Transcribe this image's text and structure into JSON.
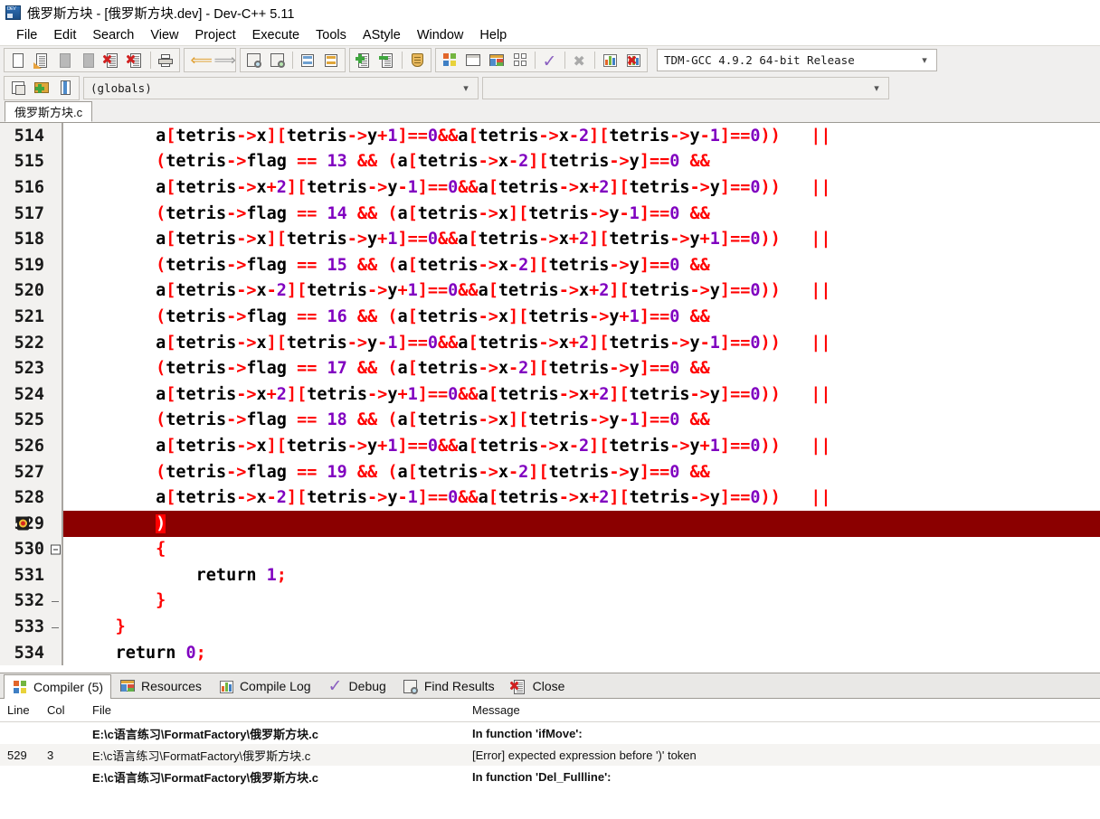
{
  "window": {
    "title": "俄罗斯方块 - [俄罗斯方块.dev] - Dev-C++ 5.11",
    "app_icon": "dev-cpp-icon"
  },
  "menubar": {
    "items": [
      "File",
      "Edit",
      "Search",
      "View",
      "Project",
      "Execute",
      "Tools",
      "AStyle",
      "Window",
      "Help"
    ]
  },
  "toolbar": {
    "groups": [
      {
        "name": "file-group",
        "buttons": [
          {
            "name": "new-file-button",
            "icon": "new-file-icon"
          },
          {
            "name": "open-file-button",
            "icon": "open-file-icon"
          },
          {
            "name": "save-file-button",
            "icon": "save-file-icon"
          },
          {
            "name": "save-all-button",
            "icon": "save-all-icon"
          },
          {
            "name": "close-file-button",
            "icon": "close-file-icon"
          },
          {
            "name": "close-all-button",
            "icon": "close-all-icon"
          },
          {
            "name": "print-button",
            "icon": "print-icon"
          }
        ]
      },
      {
        "name": "undo-group",
        "buttons": [
          {
            "name": "undo-button",
            "icon": "undo-arrow-icon"
          },
          {
            "name": "redo-button",
            "icon": "redo-arrow-icon"
          }
        ]
      },
      {
        "name": "find-group",
        "buttons": [
          {
            "name": "find-button",
            "icon": "find-magnifier-icon"
          },
          {
            "name": "replace-button",
            "icon": "replace-magnifier-icon"
          },
          {
            "name": "goto-line-button",
            "icon": "goto-line-icon"
          },
          {
            "name": "goto-function-button",
            "icon": "goto-function-icon"
          }
        ]
      },
      {
        "name": "project-group",
        "buttons": [
          {
            "name": "add-to-project-button",
            "icon": "add-plus-icon"
          },
          {
            "name": "remove-from-project-button",
            "icon": "remove-minus-icon"
          },
          {
            "name": "project-options-button",
            "icon": "shield-icon"
          }
        ]
      },
      {
        "name": "build-group",
        "buttons": [
          {
            "name": "compile-button",
            "icon": "compile-grid-icon"
          },
          {
            "name": "run-button",
            "icon": "run-window-icon"
          },
          {
            "name": "compile-run-button",
            "icon": "compile-run-icon"
          },
          {
            "name": "rebuild-all-button",
            "icon": "rebuild-grid-icon"
          },
          {
            "name": "syntax-check-button",
            "icon": "check-mark-icon"
          },
          {
            "name": "stop-execution-button",
            "icon": "stop-x-icon"
          },
          {
            "name": "profile-button",
            "icon": "profile-bars-icon"
          },
          {
            "name": "delete-profile-button",
            "icon": "delete-profile-icon"
          }
        ]
      }
    ],
    "compiler_select": {
      "name": "compiler-select",
      "value": "TDM-GCC 4.9.2 64-bit Release"
    },
    "row2": {
      "buttons": [
        {
          "name": "new-project-button",
          "icon": "new-project-icon"
        },
        {
          "name": "add-source-button",
          "icon": "add-source-icon"
        },
        {
          "name": "toggle-bookmark-button",
          "icon": "bookmark-icon"
        }
      ],
      "scope_select": {
        "name": "scope-select",
        "value": "(globals)"
      },
      "member_select": {
        "name": "member-select",
        "value": ""
      }
    }
  },
  "editor": {
    "tab_label": "俄罗斯方块.c",
    "error_line_number": 529,
    "lines": [
      {
        "num": "514",
        "text": "        a[tetris->x][tetris->y+1]==0&&a[tetris->x-2][tetris->y-1]==0))   ||",
        "fold": ""
      },
      {
        "num": "515",
        "text": "        (tetris->flag == 13 && (a[tetris->x-2][tetris->y]==0 &&",
        "fold": ""
      },
      {
        "num": "516",
        "text": "        a[tetris->x+2][tetris->y-1]==0&&a[tetris->x+2][tetris->y]==0))   ||",
        "fold": ""
      },
      {
        "num": "517",
        "text": "        (tetris->flag == 14 && (a[tetris->x][tetris->y-1]==0 &&",
        "fold": ""
      },
      {
        "num": "518",
        "text": "        a[tetris->x][tetris->y+1]==0&&a[tetris->x+2][tetris->y+1]==0))   ||",
        "fold": ""
      },
      {
        "num": "519",
        "text": "        (tetris->flag == 15 && (a[tetris->x-2][tetris->y]==0 &&",
        "fold": ""
      },
      {
        "num": "520",
        "text": "        a[tetris->x-2][tetris->y+1]==0&&a[tetris->x+2][tetris->y]==0))   ||",
        "fold": ""
      },
      {
        "num": "521",
        "text": "        (tetris->flag == 16 && (a[tetris->x][tetris->y+1]==0 &&",
        "fold": ""
      },
      {
        "num": "522",
        "text": "        a[tetris->x][tetris->y-1]==0&&a[tetris->x+2][tetris->y-1]==0))   ||",
        "fold": ""
      },
      {
        "num": "523",
        "text": "        (tetris->flag == 17 && (a[tetris->x-2][tetris->y]==0 &&",
        "fold": ""
      },
      {
        "num": "524",
        "text": "        a[tetris->x+2][tetris->y+1]==0&&a[tetris->x+2][tetris->y]==0))   ||",
        "fold": ""
      },
      {
        "num": "525",
        "text": "        (tetris->flag == 18 && (a[tetris->x][tetris->y-1]==0 &&",
        "fold": ""
      },
      {
        "num": "526",
        "text": "        a[tetris->x][tetris->y+1]==0&&a[tetris->x-2][tetris->y+1]==0))   ||",
        "fold": ""
      },
      {
        "num": "527",
        "text": "        (tetris->flag == 19 && (a[tetris->x-2][tetris->y]==0 &&",
        "fold": ""
      },
      {
        "num": "528",
        "text": "        a[tetris->x-2][tetris->y-1]==0&&a[tetris->x+2][tetris->y]==0))   ||",
        "fold": ""
      },
      {
        "num": "529",
        "text": "        )",
        "fold": "",
        "error": true
      },
      {
        "num": "530",
        "text": "        {",
        "fold": "box"
      },
      {
        "num": "531",
        "text": "            return 1;",
        "fold": ""
      },
      {
        "num": "532",
        "text": "        }",
        "fold": "tick"
      },
      {
        "num": "533",
        "text": "    }",
        "fold": "tick"
      },
      {
        "num": "534",
        "text": "    return 0;",
        "fold": ""
      }
    ]
  },
  "bottom_panel": {
    "tabs": [
      {
        "label": "Compiler (5)",
        "icon": "compiler-grid-icon",
        "name": "tab-compiler",
        "active": true
      },
      {
        "label": "Resources",
        "icon": "resources-icon",
        "name": "tab-resources",
        "active": false
      },
      {
        "label": "Compile Log",
        "icon": "compile-log-icon",
        "name": "tab-compile-log",
        "active": false
      },
      {
        "label": "Debug",
        "icon": "debug-check-icon",
        "name": "tab-debug",
        "active": false
      },
      {
        "label": "Find Results",
        "icon": "find-results-icon",
        "name": "tab-find-results",
        "active": false
      },
      {
        "label": "Close",
        "icon": "close-x-icon",
        "name": "tab-close",
        "active": false
      }
    ],
    "columns": [
      "Line",
      "Col",
      "File",
      "Message"
    ],
    "rows": [
      {
        "line": "",
        "col": "",
        "file": "E:\\c语言练习\\FormatFactory\\俄罗斯方块.c",
        "message": "In function 'ifMove':",
        "bold": true
      },
      {
        "line": "529",
        "col": "3",
        "file": "E:\\c语言练习\\FormatFactory\\俄罗斯方块.c",
        "message": "[Error] expected expression before ')' token",
        "bold": false
      },
      {
        "line": "",
        "col": "",
        "file": "E:\\c语言练习\\FormatFactory\\俄罗斯方块.c",
        "message": "In function 'Del_Fullline':",
        "bold": true
      }
    ]
  },
  "colors": {
    "error_highlight": "#8b0000",
    "cursor_selection": "#ff0000",
    "operator": "#ff0000",
    "number": "#8000c0",
    "identifier": "#000000"
  }
}
